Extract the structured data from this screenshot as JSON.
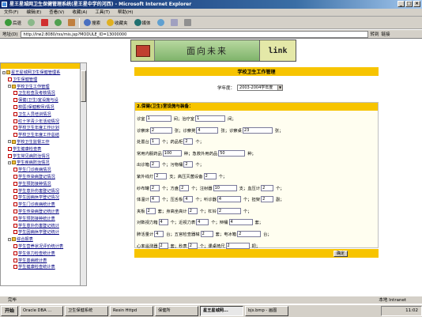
{
  "window": {
    "title": "星王星城网卫生保健管理系统(星王星中学的河西) - Microsoft Internet Explorer"
  },
  "menu": [
    "文件(F)",
    "编辑(E)",
    "查看(V)",
    "收藏(A)",
    "工具(T)",
    "帮助(H)"
  ],
  "toolbar": {
    "back": "后退",
    "search": "搜索",
    "favorites": "收藏夹",
    "media": "媒体"
  },
  "address": {
    "label": "地址(D)",
    "url": "http://lrw2:8080/rxs/mis.jsp?MODULE_ID=13000000",
    "go": "转到",
    "links": "链接"
  },
  "banner": {
    "slogan": "面向未来",
    "link": "link"
  },
  "sidebar": {
    "items": [
      {
        "label": "星王星城网卫生保健管理系",
        "type": "folder",
        "indent": 0
      },
      {
        "label": "卫生保健管理",
        "type": "doc",
        "indent": 1
      },
      {
        "label": "学校卫生工作管理",
        "type": "folder",
        "indent": 1
      },
      {
        "label": "卫生检查及考核情况",
        "type": "doc",
        "indent": 2
      },
      {
        "label": "保健(卫生)室设施与设",
        "type": "doc",
        "indent": 2
      },
      {
        "label": "校医(保健教师)情况",
        "type": "doc",
        "indent": 2
      },
      {
        "label": "卫生人员培训情况",
        "type": "doc",
        "indent": 2
      },
      {
        "label": "红十字青少年活动情况",
        "type": "doc",
        "indent": 2
      },
      {
        "label": "学校卫生年度工作计划",
        "type": "doc",
        "indent": 2
      },
      {
        "label": "学校卫生年度工作总结",
        "type": "doc",
        "indent": 2
      },
      {
        "label": "学校卫生监督工作",
        "type": "folder",
        "indent": 1
      },
      {
        "label": "学生健康检查表",
        "type": "doc",
        "indent": 1
      },
      {
        "label": "学生常见病防治情况",
        "type": "doc",
        "indent": 1
      },
      {
        "label": "学生疾病防治情况",
        "type": "folder",
        "indent": 1
      },
      {
        "label": "学生门诊疾病情况",
        "type": "doc",
        "indent": 2
      },
      {
        "label": "学生传染病登记情况",
        "type": "doc",
        "indent": 2
      },
      {
        "label": "学生预防接种情况",
        "type": "doc",
        "indent": 2
      },
      {
        "label": "学生意外伤害登记情况",
        "type": "doc",
        "indent": 2
      },
      {
        "label": "学生因病休学登记情况",
        "type": "doc",
        "indent": 2
      },
      {
        "label": "学生门诊疾病统计表",
        "type": "doc",
        "indent": 2
      },
      {
        "label": "学生传染病登记统计表",
        "type": "doc",
        "indent": 2
      },
      {
        "label": "学生预防接种统计表",
        "type": "doc",
        "indent": 2
      },
      {
        "label": "学生意外伤害登记统计",
        "type": "doc",
        "indent": 2
      },
      {
        "label": "学生因病休学登记统计",
        "type": "doc",
        "indent": 2
      },
      {
        "label": "综合报表",
        "type": "folder",
        "indent": 1
      },
      {
        "label": "学生营养状况评价统计表",
        "type": "doc",
        "indent": 2
      },
      {
        "label": "学生体力检查统计表",
        "type": "doc",
        "indent": 2
      },
      {
        "label": "学生患病统计表",
        "type": "doc",
        "indent": 2
      },
      {
        "label": "学生健康检查统计表",
        "type": "doc",
        "indent": 2
      }
    ]
  },
  "page": {
    "title": "学校卫生工作管理",
    "year_label": "学年度：",
    "year_value": "2003-2004学年度",
    "form_header": "2.保健(卫生)室设施与装备：",
    "rows": [
      [
        {
          "t": "诊室"
        },
        {
          "v": "1",
          "w": 32
        },
        {
          "t": "间；治疗室"
        },
        {
          "v": "1",
          "w": 38
        },
        {
          "t": "间；"
        }
      ],
      [
        {
          "t": "诊察床"
        },
        {
          "v": "2",
          "w": 28
        },
        {
          "t": "张；诊察凳"
        },
        {
          "v": "4",
          "w": 28
        },
        {
          "t": "张；诊察桌"
        },
        {
          "v": "23",
          "w": 38
        },
        {
          "t": "张；"
        }
      ],
      [
        {
          "t": "处置台"
        },
        {
          "v": "1",
          "w": 12
        },
        {
          "t": "个；药品柜"
        },
        {
          "v": "2",
          "w": 12
        },
        {
          "t": "个；"
        }
      ],
      [
        {
          "t": "常用内服药品"
        },
        {
          "v": "100",
          "w": 24
        },
        {
          "t": "种；急救外用药品"
        },
        {
          "v": "50",
          "w": 34
        },
        {
          "t": "种；"
        }
      ],
      [
        {
          "t": "出诊箱"
        },
        {
          "v": "2",
          "w": 12
        },
        {
          "t": "个；污物桶"
        },
        {
          "v": "2",
          "w": 12
        },
        {
          "t": "个；"
        }
      ],
      [
        {
          "t": "紫外线灯"
        },
        {
          "v": "2",
          "w": 16
        },
        {
          "t": "支；高压灭菌设备"
        },
        {
          "v": "2",
          "w": 16
        },
        {
          "t": "个；"
        }
      ],
      [
        {
          "t": "纱布罐"
        },
        {
          "v": "2",
          "w": 12
        },
        {
          "t": "个；方盘"
        },
        {
          "v": "2",
          "w": 12
        },
        {
          "t": "个；注射器"
        },
        {
          "v": "10",
          "w": 30
        },
        {
          "t": "支；血压计"
        },
        {
          "v": "2",
          "w": 16
        },
        {
          "t": "个；"
        }
      ],
      [
        {
          "t": "体温计"
        },
        {
          "v": "4",
          "w": 12
        },
        {
          "t": "个；压舌板"
        },
        {
          "v": "4",
          "w": 12
        },
        {
          "t": "个；听诊器"
        },
        {
          "v": "4",
          "w": 30
        },
        {
          "t": "个；担架"
        },
        {
          "v": "2",
          "w": 16
        },
        {
          "t": "副；"
        }
      ],
      [
        {
          "t": "夹板"
        },
        {
          "v": "2",
          "w": 12
        },
        {
          "t": "套；身高坐高计"
        },
        {
          "v": "2",
          "w": 12
        },
        {
          "t": "个；杠铃"
        },
        {
          "v": "2",
          "w": 30
        },
        {
          "t": "个；"
        }
      ],
      [
        {
          "t": "对数视力箱"
        },
        {
          "v": "4",
          "w": 12
        },
        {
          "t": "个；近视力表"
        },
        {
          "v": "4",
          "w": 16
        },
        {
          "t": "个；辩桶"
        },
        {
          "v": "4",
          "w": 30
        },
        {
          "t": "套；"
        }
      ],
      [
        {
          "t": "肺活量计"
        },
        {
          "v": "4",
          "w": 12
        },
        {
          "t": "台；五官检查器械"
        },
        {
          "v": "2",
          "w": 16
        },
        {
          "t": "套；电冰箱"
        },
        {
          "v": "2",
          "w": 30
        },
        {
          "t": "台；"
        }
      ],
      [
        {
          "t": "心率遥测器"
        },
        {
          "v": "2",
          "w": 12
        },
        {
          "t": "套；秒表"
        },
        {
          "v": "2",
          "w": 12
        },
        {
          "t": "个；课桌椅尺"
        },
        {
          "v": "2",
          "w": 30
        },
        {
          "t": "把；"
        }
      ]
    ],
    "submit": "确定"
  },
  "status": {
    "left": "完毕",
    "zone": "本地 Intranet"
  },
  "taskbar": {
    "start": "开始",
    "tasks": [
      "Oracle DBA ...",
      "卫生保健系统",
      "Resin Httpd",
      "保健所",
      "星王星城网...",
      "bjs.bmp - 画图"
    ],
    "active_index": 4,
    "clock": "11:02"
  }
}
